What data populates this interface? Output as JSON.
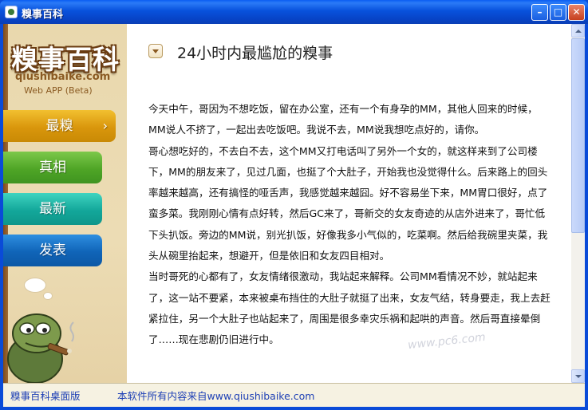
{
  "window": {
    "title": "糗事百科"
  },
  "logo": {
    "title": "糗事百科",
    "domain": "qiushibaike.com",
    "subtitle": "Web APP (Beta)"
  },
  "nav": [
    {
      "label": "最糗",
      "active": true
    },
    {
      "label": "真相"
    },
    {
      "label": "最新"
    },
    {
      "label": "发表"
    }
  ],
  "post": {
    "title": "24小时内最尴尬的糗事",
    "paragraphs": [
      "今天中午，哥因为不想吃饭，留在办公室，还有一个有身孕的MM，其他人回来的时候，MM说人不挤了，一起出去吃饭吧。我说不去，MM说我想吃点好的，请你。",
      "哥心想吃好的，不去白不去，这个MM又打电话叫了另外一个女的，就这样来到了公司楼下，MM的朋友来了，见过几面，也挺了个大肚子，开始我也没觉得什么。后来路上的回头率越来越高，还有搞怪的哑舌声，我感觉越来越囧。好不容易坐下来，MM胃口很好，点了蛮多菜。我刚刚心情有点好转，然后GC来了，哥新交的女友奇迹的从店外进来了，哥忙低下头扒饭。旁边的MM说，别光扒饭，好像我多小气似的，吃菜啊。然后给我碗里夹菜，我头从碗里抬起来，想避开，但是依旧和女友四目相对。",
      "当时哥死的心都有了，女友情绪很激动，我站起来解释。公司MM看情况不妙，就站起来了，这一站不要紧，本来被桌布挡住的大肚子就挺了出来，女友气结，转身要走，我上去赶紧拉住，另一个大肚子也站起来了，周围是很多幸灾乐祸和起哄的声音。然后哥直接晕倒了……现在悲剧仍旧进行中。"
    ]
  },
  "watermark": "www.pc6.com",
  "statusbar": {
    "left": "糗事百科桌面版",
    "right": "本软件所有内容来自www.qiushibaike.com"
  }
}
